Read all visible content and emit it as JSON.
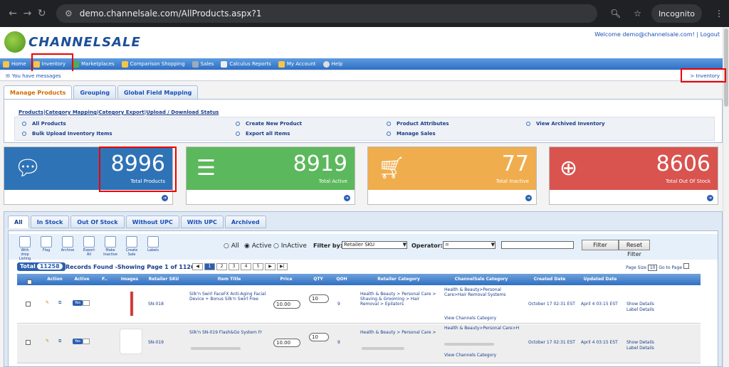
{
  "browser": {
    "url": "demo.channelsale.com/AllProducts.aspx?1",
    "incognito_label": "Incognito"
  },
  "header": {
    "logo": "CHANNELSALE",
    "welcome": "Welcome demo@channelsale.com! | Logout"
  },
  "menu": [
    {
      "label": "Home"
    },
    {
      "label": "Inventory"
    },
    {
      "label": "Marketplaces"
    },
    {
      "label": "Comparison Shopping"
    },
    {
      "label": "Sales"
    },
    {
      "label": "Calculus Reports"
    },
    {
      "label": "My Account"
    },
    {
      "label": "Help"
    }
  ],
  "messages": "You have messages",
  "breadcrumb": "> Inventory",
  "top_tabs": [
    "Manage Products",
    "Grouping",
    "Global Field Mapping"
  ],
  "sub_links": [
    "Products",
    "|Category Mapping",
    "|Category Export",
    "|Upload / Download Status"
  ],
  "actions": [
    "All Products",
    "Bulk Upload Inventory Items",
    "Create New Product",
    "Export all Items",
    "Product Attributes",
    "Manage Sales",
    "View Archived Inventory"
  ],
  "cards": [
    {
      "value": "8996",
      "label": "Total Products",
      "color": "#2f73b7"
    },
    {
      "value": "8919",
      "label": "Total Active",
      "color": "#5cb85c"
    },
    {
      "value": "77",
      "label": "Total Inactive",
      "color": "#f0ad4e"
    },
    {
      "value": "8606",
      "label": "Total Out Of Stock",
      "color": "#d9534f"
    }
  ],
  "filter_tabs": [
    "All",
    "In Stock",
    "Out Of Stock",
    "Without UPC",
    "With UPC",
    "Archived"
  ],
  "toolbar": [
    "With drop Listing",
    "Flag",
    "Archive",
    "Export All",
    "Make Inactive",
    "Create Sale",
    "Labels"
  ],
  "status_radios": [
    "All",
    "Active",
    "InActive"
  ],
  "filter": {
    "filter_by_label": "Filter by:",
    "filter_by_value": "Retailer SKU",
    "operator_label": "Operator:",
    "operator_value": "=",
    "button": "Filter",
    "reset": "Reset Filter"
  },
  "total": {
    "label": "Total",
    "count": "11258",
    "records": "Records Found -Showing Page 1 of 1126",
    "pages": [
      "1",
      "2",
      "3",
      "4",
      "5"
    ],
    "page_size_label": "Page Size",
    "page_size": "10",
    "goto": "Go to Page"
  },
  "columns": [
    "Action",
    "Active",
    "F..",
    "Images",
    "Retailer SKU",
    "Item Title",
    "Price",
    "QTY",
    "QOH",
    "Retailer Category",
    "ChannelSale Category",
    "Created Date",
    "Updated Date"
  ],
  "rows": [
    {
      "active": "Yes",
      "sku": "SN-018",
      "title": "Silk'n Swirl FaceFX Anti-Aging Facial Device + Bonus Silk'n Swirl Free",
      "price": "10.00",
      "qty": "10",
      "qoh": "9",
      "retailer_cat": "Health & Beauty > Personal Care > Shaving & Grooming > Hair Removal > Epilators",
      "cs_cat": "Health & Beauty>Personal Care>Hair Removal Systems",
      "view_cat": "View Channels Category",
      "created": "October 17 02:31 EST",
      "updated": "April 4 03:15 EST",
      "show": "Show Details",
      "label_det": "Label Details"
    },
    {
      "active": "Yes",
      "sku": "SN-019",
      "title": "Silk'n SN-019 Flash&Go System Fr",
      "price": "10.00",
      "qty": "10",
      "qoh": "9",
      "retailer_cat": "Health & Beauty > Personal Care >",
      "cs_cat": "Health & Beauty>Personal Care>H",
      "view_cat": "View Channels Category",
      "created": "October 17 02:31 EST",
      "updated": "April 4 03:15 EST",
      "show": "Show Details",
      "label_det": "Label Details"
    }
  ]
}
